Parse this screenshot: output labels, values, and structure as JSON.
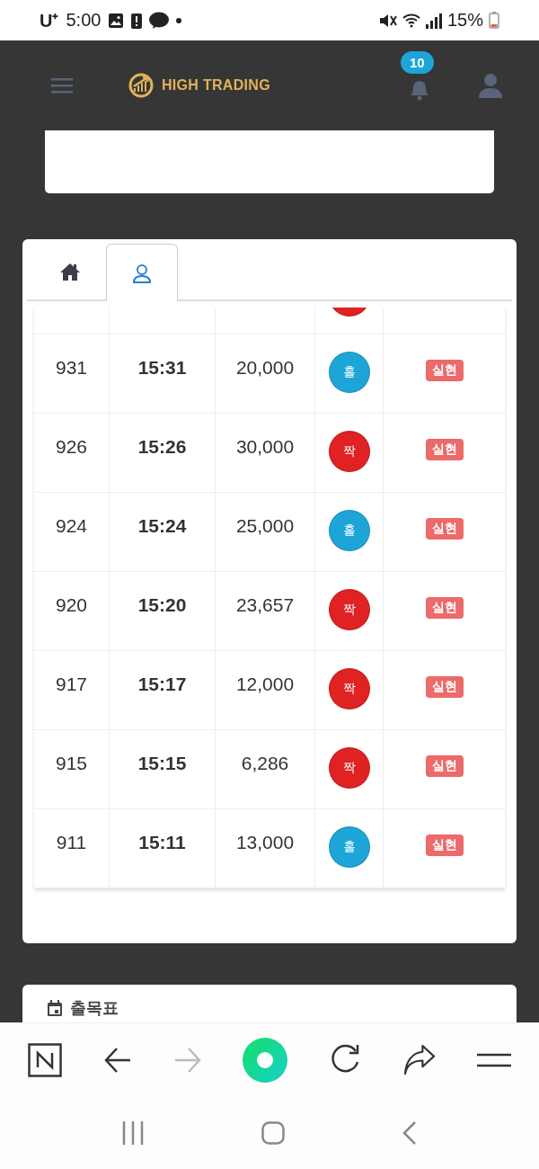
{
  "status_bar": {
    "carrier": "U⁺",
    "time": "5:00",
    "battery": "15%"
  },
  "header": {
    "brand": "HIGH TRADING",
    "notification_count": "10"
  },
  "tabs": [
    {
      "kind": "home",
      "selected": false
    },
    {
      "kind": "user",
      "selected": true
    }
  ],
  "table": {
    "partial_row": {
      "kind": "even"
    },
    "rows": [
      {
        "number": "931",
        "time": "15:31",
        "amount": "20,000",
        "kind": "odd",
        "result": "홀",
        "status": "실현"
      },
      {
        "number": "926",
        "time": "15:26",
        "amount": "30,000",
        "kind": "even",
        "result": "짝",
        "status": "실현"
      },
      {
        "number": "924",
        "time": "15:24",
        "amount": "25,000",
        "kind": "odd",
        "result": "홀",
        "status": "실현"
      },
      {
        "number": "920",
        "time": "15:20",
        "amount": "23,657",
        "kind": "even",
        "result": "짝",
        "status": "실현"
      },
      {
        "number": "917",
        "time": "15:17",
        "amount": "12,000",
        "kind": "even",
        "result": "짝",
        "status": "실현"
      },
      {
        "number": "915",
        "time": "15:15",
        "amount": "6,286",
        "kind": "even",
        "result": "짝",
        "status": "실현"
      },
      {
        "number": "911",
        "time": "15:11",
        "amount": "13,000",
        "kind": "odd",
        "result": "홀",
        "status": "실현"
      }
    ]
  },
  "schedule_card": {
    "title": "출목표"
  },
  "browser_toolbar": {
    "forward_disabled": true
  }
}
